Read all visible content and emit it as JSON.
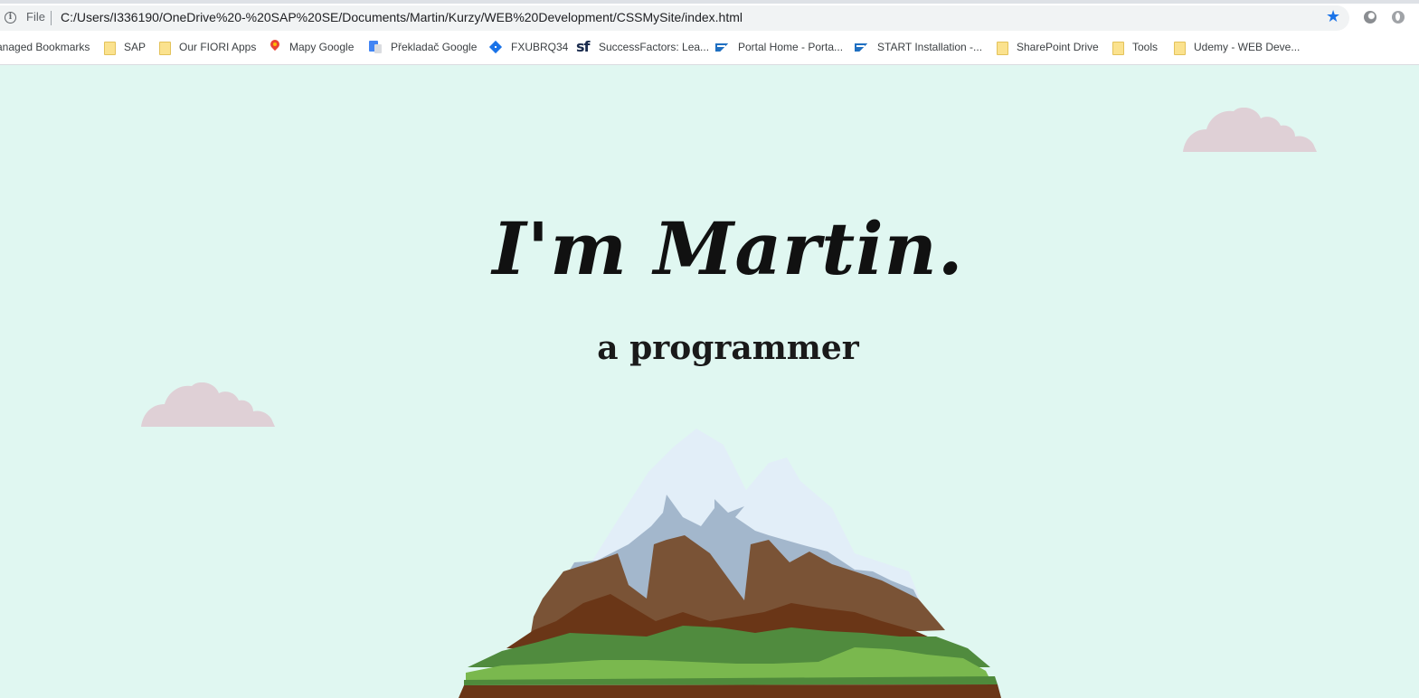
{
  "browser": {
    "scheme_label": "File",
    "url": "C:/Users/I336190/OneDrive%20-%20SAP%20SE/Documents/Martin/Kurzy/WEB%20Development/CSSMySite/index.html",
    "bookmarks": [
      {
        "label": "anaged Bookmarks",
        "icon": "none"
      },
      {
        "label": "SAP",
        "icon": "folder-icon"
      },
      {
        "label": "Our FIORI Apps",
        "icon": "folder-icon"
      },
      {
        "label": "Mapy Google",
        "icon": "maps-icon"
      },
      {
        "label": "Překladač Google",
        "icon": "translate-icon"
      },
      {
        "label": "FXUBRQ34",
        "icon": "diamond-icon"
      },
      {
        "label": "SuccessFactors: Lea...",
        "icon": "successfactors-icon"
      },
      {
        "label": "Portal Home - Porta...",
        "icon": "sap-icon"
      },
      {
        "label": "START Installation -...",
        "icon": "sap-icon"
      },
      {
        "label": "SharePoint Drive",
        "icon": "folder-icon"
      },
      {
        "label": "Tools",
        "icon": "folder-icon"
      },
      {
        "label": "Udemy - WEB Deve...",
        "icon": "folder-icon"
      }
    ],
    "sf_glyph": "sf"
  },
  "page": {
    "title": "I'm Martin.",
    "subtitle": "a programmer"
  },
  "colors": {
    "background": "#e0f7f1",
    "cloud": "#dfd0d6",
    "bookmark_star": "#1a73e8"
  }
}
